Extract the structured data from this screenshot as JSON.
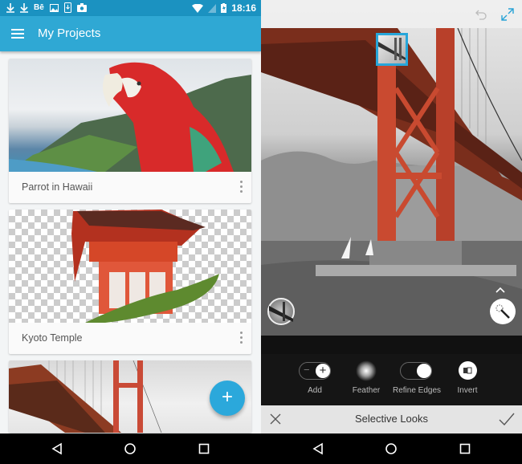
{
  "left": {
    "status_bar": {
      "time": "18:16",
      "icons": [
        "download-icon",
        "download-icon",
        "behance-icon",
        "image-icon",
        "phone-download-icon",
        "camera-icon"
      ],
      "right_icons": [
        "wifi-icon",
        "no-signal-icon",
        "battery-icon"
      ],
      "behance_glyph": "Bē"
    },
    "app_bar": {
      "title": "My Projects"
    },
    "projects": [
      {
        "title": "Parrot in Hawaii"
      },
      {
        "title": "Kyoto Temple"
      },
      {
        "title": ""
      }
    ],
    "fab": {
      "label": "+"
    }
  },
  "right": {
    "editor": {
      "title": "Selective Looks",
      "tools": [
        {
          "label": "Add",
          "minus": "−",
          "plus": "+"
        },
        {
          "label": "Feather"
        },
        {
          "label": "Refine Edges"
        },
        {
          "label": "Invert"
        }
      ]
    }
  },
  "colors": {
    "accent": "#2fa8d4",
    "status_bar": "#1b92c1",
    "fab": "#2ba8db",
    "thumb_border": "#27a6da"
  }
}
